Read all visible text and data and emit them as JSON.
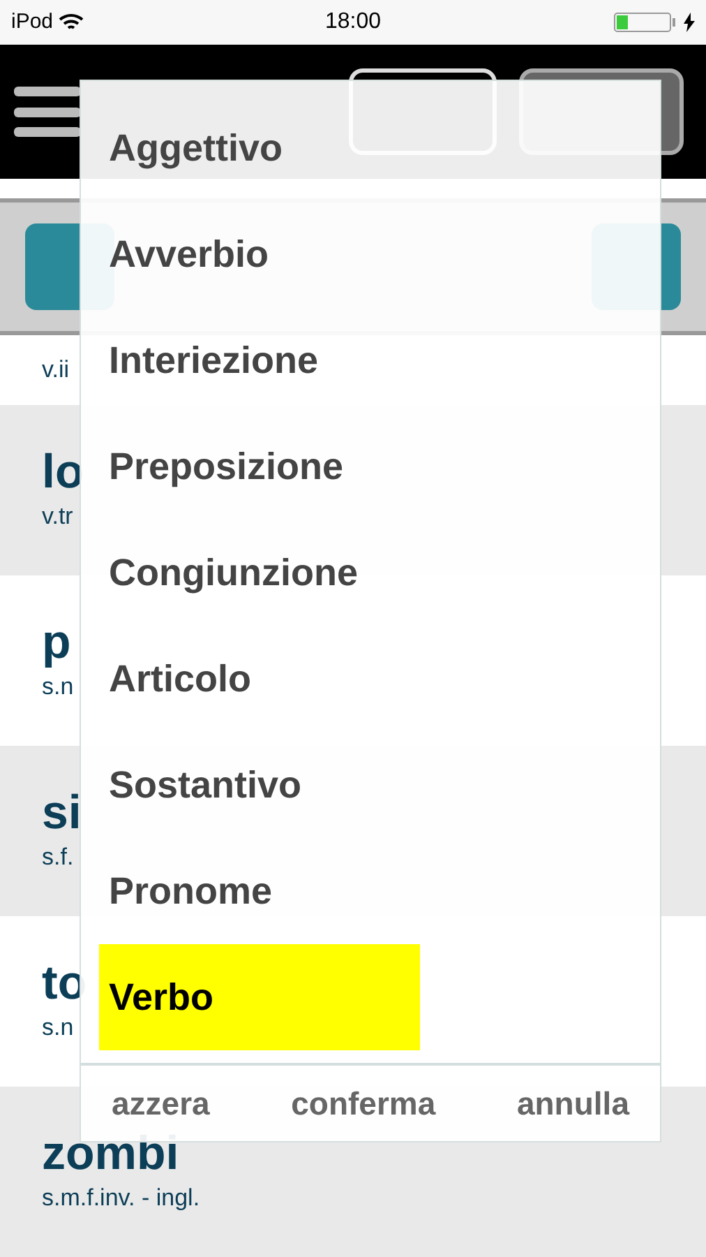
{
  "status_bar": {
    "device": "iPod",
    "time": "18:00"
  },
  "entries": [
    {
      "info": "v.ii"
    },
    {
      "word": "lo",
      "info": "v.tr"
    },
    {
      "word": "p",
      "info": "s.n"
    },
    {
      "word": "si",
      "info": "s.f."
    },
    {
      "word": "to",
      "info": "s.n"
    },
    {
      "word": "zombi",
      "info": "s.m.f.inv. - ingl."
    }
  ],
  "picker": {
    "options": [
      {
        "label": "Aggettivo",
        "selected": false
      },
      {
        "label": "Avverbio",
        "selected": false
      },
      {
        "label": "Interiezione",
        "selected": false
      },
      {
        "label": "Preposizione",
        "selected": false
      },
      {
        "label": "Congiunzione",
        "selected": false
      },
      {
        "label": "Articolo",
        "selected": false
      },
      {
        "label": "Sostantivo",
        "selected": false
      },
      {
        "label": "Pronome",
        "selected": false
      },
      {
        "label": "Verbo",
        "selected": true
      }
    ],
    "buttons": [
      "azzera",
      "conferma",
      "annulla"
    ]
  }
}
